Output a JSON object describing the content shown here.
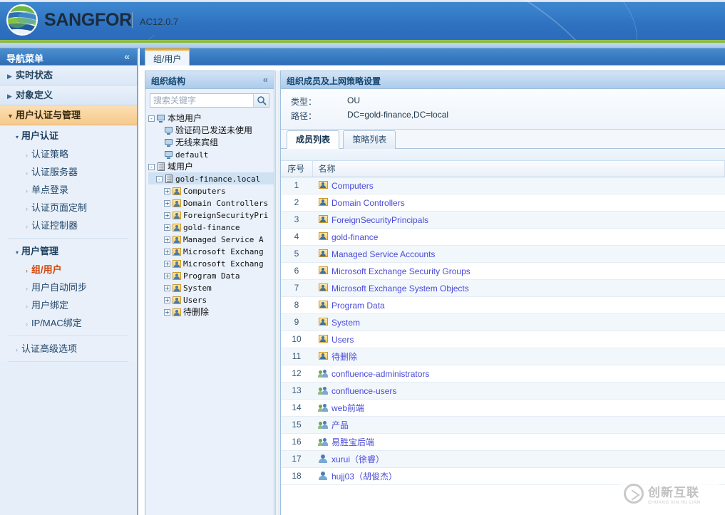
{
  "brand": {
    "name": "SANGFOR",
    "separator": "|",
    "version": "AC12.0.7",
    "logo_icon": "globe-icon"
  },
  "nav": {
    "header_title": "导航菜单",
    "collapse_icon": "chevron-double-left-icon",
    "top_items": [
      {
        "label": "实时状态",
        "expanded": false,
        "active": false
      },
      {
        "label": "对象定义",
        "expanded": false,
        "active": false
      },
      {
        "label": "用户认证与管理",
        "expanded": true,
        "active": true
      }
    ],
    "groups": [
      {
        "label": "用户认证",
        "items": [
          {
            "label": "认证策略",
            "selected": false
          },
          {
            "label": "认证服务器",
            "selected": false
          },
          {
            "label": "单点登录",
            "selected": false
          },
          {
            "label": "认证页面定制",
            "selected": false
          },
          {
            "label": "认证控制器",
            "selected": false
          }
        ]
      },
      {
        "label": "用户管理",
        "items": [
          {
            "label": "组/用户",
            "selected": true
          },
          {
            "label": "用户自动同步",
            "selected": false
          },
          {
            "label": "用户绑定",
            "selected": false
          },
          {
            "label": "IP/MAC绑定",
            "selected": false
          }
        ]
      }
    ],
    "footer_item": {
      "label": "认证高级选项",
      "selected": false
    }
  },
  "tabstrip": {
    "tabs": [
      {
        "label": "组/用户",
        "active": true
      }
    ]
  },
  "tree_panel": {
    "header_title": "组织结构",
    "collapse_icon": "chevron-double-left-icon",
    "search": {
      "placeholder": "搜索关键字",
      "value": "",
      "button_icon": "search-icon"
    },
    "nodes": [
      {
        "label": "本地用户",
        "depth": 0,
        "expander": "-",
        "icon": "monitor-icon",
        "cjk": true,
        "selected": false
      },
      {
        "label": "验证码已发送未使用",
        "depth": 1,
        "expander": "",
        "icon": "monitor-icon",
        "cjk": true,
        "selected": false
      },
      {
        "label": "无线来宾组",
        "depth": 1,
        "expander": "",
        "icon": "monitor-icon",
        "cjk": true,
        "selected": false
      },
      {
        "label": "default",
        "depth": 1,
        "expander": "",
        "icon": "monitor-icon",
        "cjk": false,
        "selected": false
      },
      {
        "label": "域用户",
        "depth": 0,
        "expander": "-",
        "icon": "server-icon",
        "cjk": true,
        "selected": false
      },
      {
        "label": "gold-finance.local",
        "depth": 1,
        "expander": "-",
        "icon": "server-icon",
        "cjk": false,
        "selected": true
      },
      {
        "label": "Computers",
        "depth": 2,
        "expander": "+",
        "icon": "ou-icon",
        "cjk": false,
        "selected": false
      },
      {
        "label": "Domain Controllers",
        "depth": 2,
        "expander": "+",
        "icon": "ou-icon",
        "cjk": false,
        "selected": false
      },
      {
        "label": "ForeignSecurityPri",
        "depth": 2,
        "expander": "+",
        "icon": "ou-icon",
        "cjk": false,
        "selected": false
      },
      {
        "label": "gold-finance",
        "depth": 2,
        "expander": "+",
        "icon": "ou-icon",
        "cjk": false,
        "selected": false
      },
      {
        "label": "Managed Service A",
        "depth": 2,
        "expander": "+",
        "icon": "ou-icon",
        "cjk": false,
        "selected": false
      },
      {
        "label": "Microsoft Exchang",
        "depth": 2,
        "expander": "+",
        "icon": "ou-icon",
        "cjk": false,
        "selected": false
      },
      {
        "label": "Microsoft Exchang",
        "depth": 2,
        "expander": "+",
        "icon": "ou-icon",
        "cjk": false,
        "selected": false
      },
      {
        "label": "Program Data",
        "depth": 2,
        "expander": "+",
        "icon": "ou-icon",
        "cjk": false,
        "selected": false
      },
      {
        "label": "System",
        "depth": 2,
        "expander": "+",
        "icon": "ou-icon",
        "cjk": false,
        "selected": false
      },
      {
        "label": "Users",
        "depth": 2,
        "expander": "+",
        "icon": "ou-icon",
        "cjk": false,
        "selected": false
      },
      {
        "label": "待删除",
        "depth": 2,
        "expander": "+",
        "icon": "ou-icon",
        "cjk": true,
        "selected": false
      }
    ]
  },
  "main_panel": {
    "header_title": "组织成员及上网策略设置",
    "info": {
      "type_label": "类型：",
      "type_value": "OU",
      "path_label": "路径：",
      "path_value": "DC=gold-finance,DC=local"
    },
    "tabs": [
      {
        "label": "成员列表",
        "active": true
      },
      {
        "label": "策略列表",
        "active": false
      }
    ],
    "table": {
      "columns": [
        "序号",
        "名称"
      ],
      "rows": [
        {
          "no": "1",
          "name": "Computers",
          "icon": "ou-icon"
        },
        {
          "no": "2",
          "name": "Domain Controllers",
          "icon": "ou-icon"
        },
        {
          "no": "3",
          "name": "ForeignSecurityPrincipals",
          "icon": "ou-icon"
        },
        {
          "no": "4",
          "name": "gold-finance",
          "icon": "ou-icon"
        },
        {
          "no": "5",
          "name": "Managed Service Accounts",
          "icon": "ou-icon"
        },
        {
          "no": "6",
          "name": "Microsoft Exchange Security Groups",
          "icon": "ou-icon"
        },
        {
          "no": "7",
          "name": "Microsoft Exchange System Objects",
          "icon": "ou-icon"
        },
        {
          "no": "8",
          "name": "Program Data",
          "icon": "ou-icon"
        },
        {
          "no": "9",
          "name": "System",
          "icon": "ou-icon"
        },
        {
          "no": "10",
          "name": "Users",
          "icon": "ou-icon"
        },
        {
          "no": "11",
          "name": "待删除",
          "icon": "ou-icon"
        },
        {
          "no": "12",
          "name": "confluence-administrators",
          "icon": "group-icon"
        },
        {
          "no": "13",
          "name": "confluence-users",
          "icon": "group-icon"
        },
        {
          "no": "14",
          "name": "web前端",
          "icon": "group-icon"
        },
        {
          "no": "15",
          "name": "产品",
          "icon": "group-icon"
        },
        {
          "no": "16",
          "name": "易胜宝后端",
          "icon": "group-icon"
        },
        {
          "no": "17",
          "name": "xurui（徐睿）",
          "icon": "user-icon"
        },
        {
          "no": "18",
          "name": "hujj03（胡俊杰）",
          "icon": "user-icon"
        }
      ]
    }
  },
  "watermark": {
    "cn": "创新互联",
    "en": "CHUANG XIN HU LIAN",
    "icon": "cx-ring-icon"
  },
  "colors": {
    "banner_blue": "#3a82cc",
    "green_stripe": "#8ebd47",
    "nav_active_orange": "#f6c98a",
    "selected_link_orange": "#d1440a",
    "row_link_purple": "#4a4ad8",
    "tab_accent": "#f5a91e"
  }
}
